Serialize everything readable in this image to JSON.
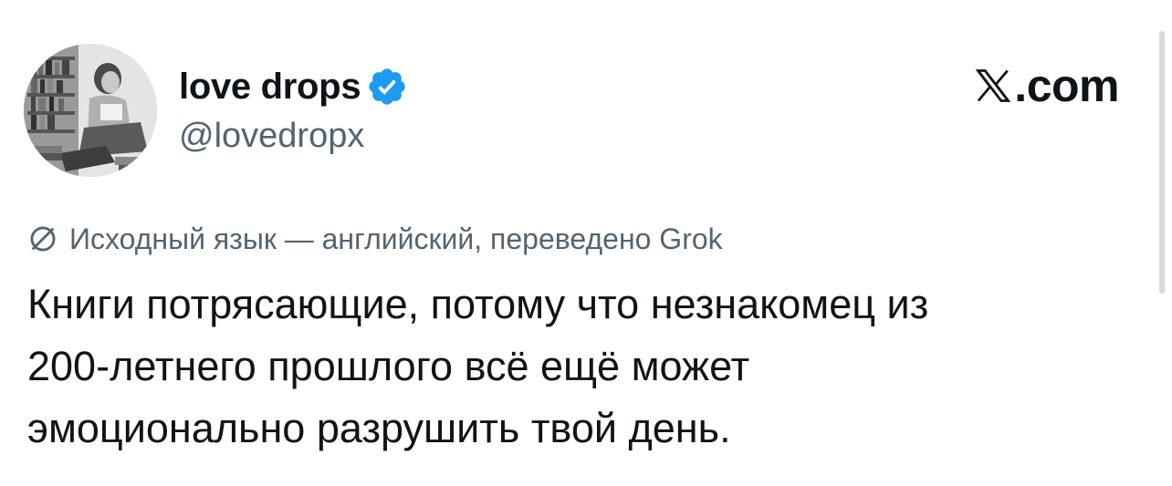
{
  "author": {
    "display_name": "love drops",
    "handle": "@lovedropx",
    "verified": true
  },
  "brand": {
    "text": ".com",
    "icon": "x-logo-icon"
  },
  "translation": {
    "icon": "translate-icon",
    "text": "Исходный язык — английский, переведено Grok"
  },
  "tweet": {
    "lines": [
      "Книги потрясающие, потому что незнакомец из",
      "200-летнего прошлого всё ещё может",
      "эмоционально разрушить твой день."
    ]
  },
  "colors": {
    "text": "#0f1419",
    "secondary": "#536471",
    "verified_badge": "#1d9bf0"
  }
}
